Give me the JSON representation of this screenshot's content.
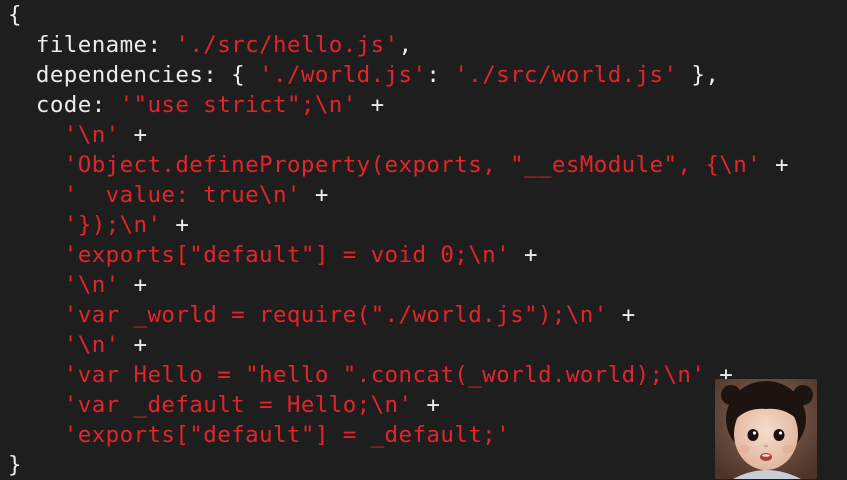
{
  "editor": {
    "lines": [
      {
        "indent": "",
        "tokens": [
          {
            "text": "{",
            "kind": "plain"
          }
        ]
      },
      {
        "indent": "  ",
        "tokens": [
          {
            "text": "filename: ",
            "kind": "plain"
          },
          {
            "text": "'./src/hello.js'",
            "kind": "string"
          },
          {
            "text": ",",
            "kind": "plain"
          }
        ]
      },
      {
        "indent": "  ",
        "tokens": [
          {
            "text": "dependencies: { ",
            "kind": "plain"
          },
          {
            "text": "'./world.js'",
            "kind": "string"
          },
          {
            "text": ": ",
            "kind": "plain"
          },
          {
            "text": "'./src/world.js'",
            "kind": "string"
          },
          {
            "text": " },",
            "kind": "plain"
          }
        ]
      },
      {
        "indent": "  ",
        "tokens": [
          {
            "text": "code: ",
            "kind": "plain"
          },
          {
            "text": "'\"use strict\";\\n'",
            "kind": "string"
          },
          {
            "text": " +",
            "kind": "plain"
          }
        ]
      },
      {
        "indent": "    ",
        "tokens": [
          {
            "text": "'\\n'",
            "kind": "string"
          },
          {
            "text": " +",
            "kind": "plain"
          }
        ]
      },
      {
        "indent": "    ",
        "tokens": [
          {
            "text": "'Object.defineProperty(exports, \"__esModule\", {\\n'",
            "kind": "string"
          },
          {
            "text": " +",
            "kind": "plain"
          }
        ]
      },
      {
        "indent": "    ",
        "tokens": [
          {
            "text": "'  value: true\\n'",
            "kind": "string"
          },
          {
            "text": " +",
            "kind": "plain"
          }
        ]
      },
      {
        "indent": "    ",
        "tokens": [
          {
            "text": "'});\\n'",
            "kind": "string"
          },
          {
            "text": " +",
            "kind": "plain"
          }
        ]
      },
      {
        "indent": "    ",
        "tokens": [
          {
            "text": "'exports[\"default\"] = void 0;\\n'",
            "kind": "string"
          },
          {
            "text": " +",
            "kind": "plain"
          }
        ]
      },
      {
        "indent": "    ",
        "tokens": [
          {
            "text": "'\\n'",
            "kind": "string"
          },
          {
            "text": " +",
            "kind": "plain"
          }
        ]
      },
      {
        "indent": "    ",
        "tokens": [
          {
            "text": "'var _world = require(\"./world.js\");\\n'",
            "kind": "string"
          },
          {
            "text": " +",
            "kind": "plain"
          }
        ]
      },
      {
        "indent": "    ",
        "tokens": [
          {
            "text": "'\\n'",
            "kind": "string"
          },
          {
            "text": " +",
            "kind": "plain"
          }
        ]
      },
      {
        "indent": "    ",
        "tokens": [
          {
            "text": "'var Hello = \"hello \".concat(_world.world);\\n'",
            "kind": "string"
          },
          {
            "text": " +",
            "kind": "plain"
          }
        ]
      },
      {
        "indent": "    ",
        "tokens": [
          {
            "text": "'var _default = Hello;\\n'",
            "kind": "string"
          },
          {
            "text": " +",
            "kind": "plain"
          }
        ]
      },
      {
        "indent": "    ",
        "tokens": [
          {
            "text": "'exports[\"default\"] = _default;'",
            "kind": "string"
          }
        ]
      },
      {
        "indent": "",
        "tokens": [
          {
            "text": "}",
            "kind": "plain"
          }
        ]
      }
    ]
  },
  "colors": {
    "background": "#1e1e1e",
    "plain_text": "#ececec",
    "string_text": "#e4242a"
  },
  "webcam": {
    "subject": "child-face"
  }
}
